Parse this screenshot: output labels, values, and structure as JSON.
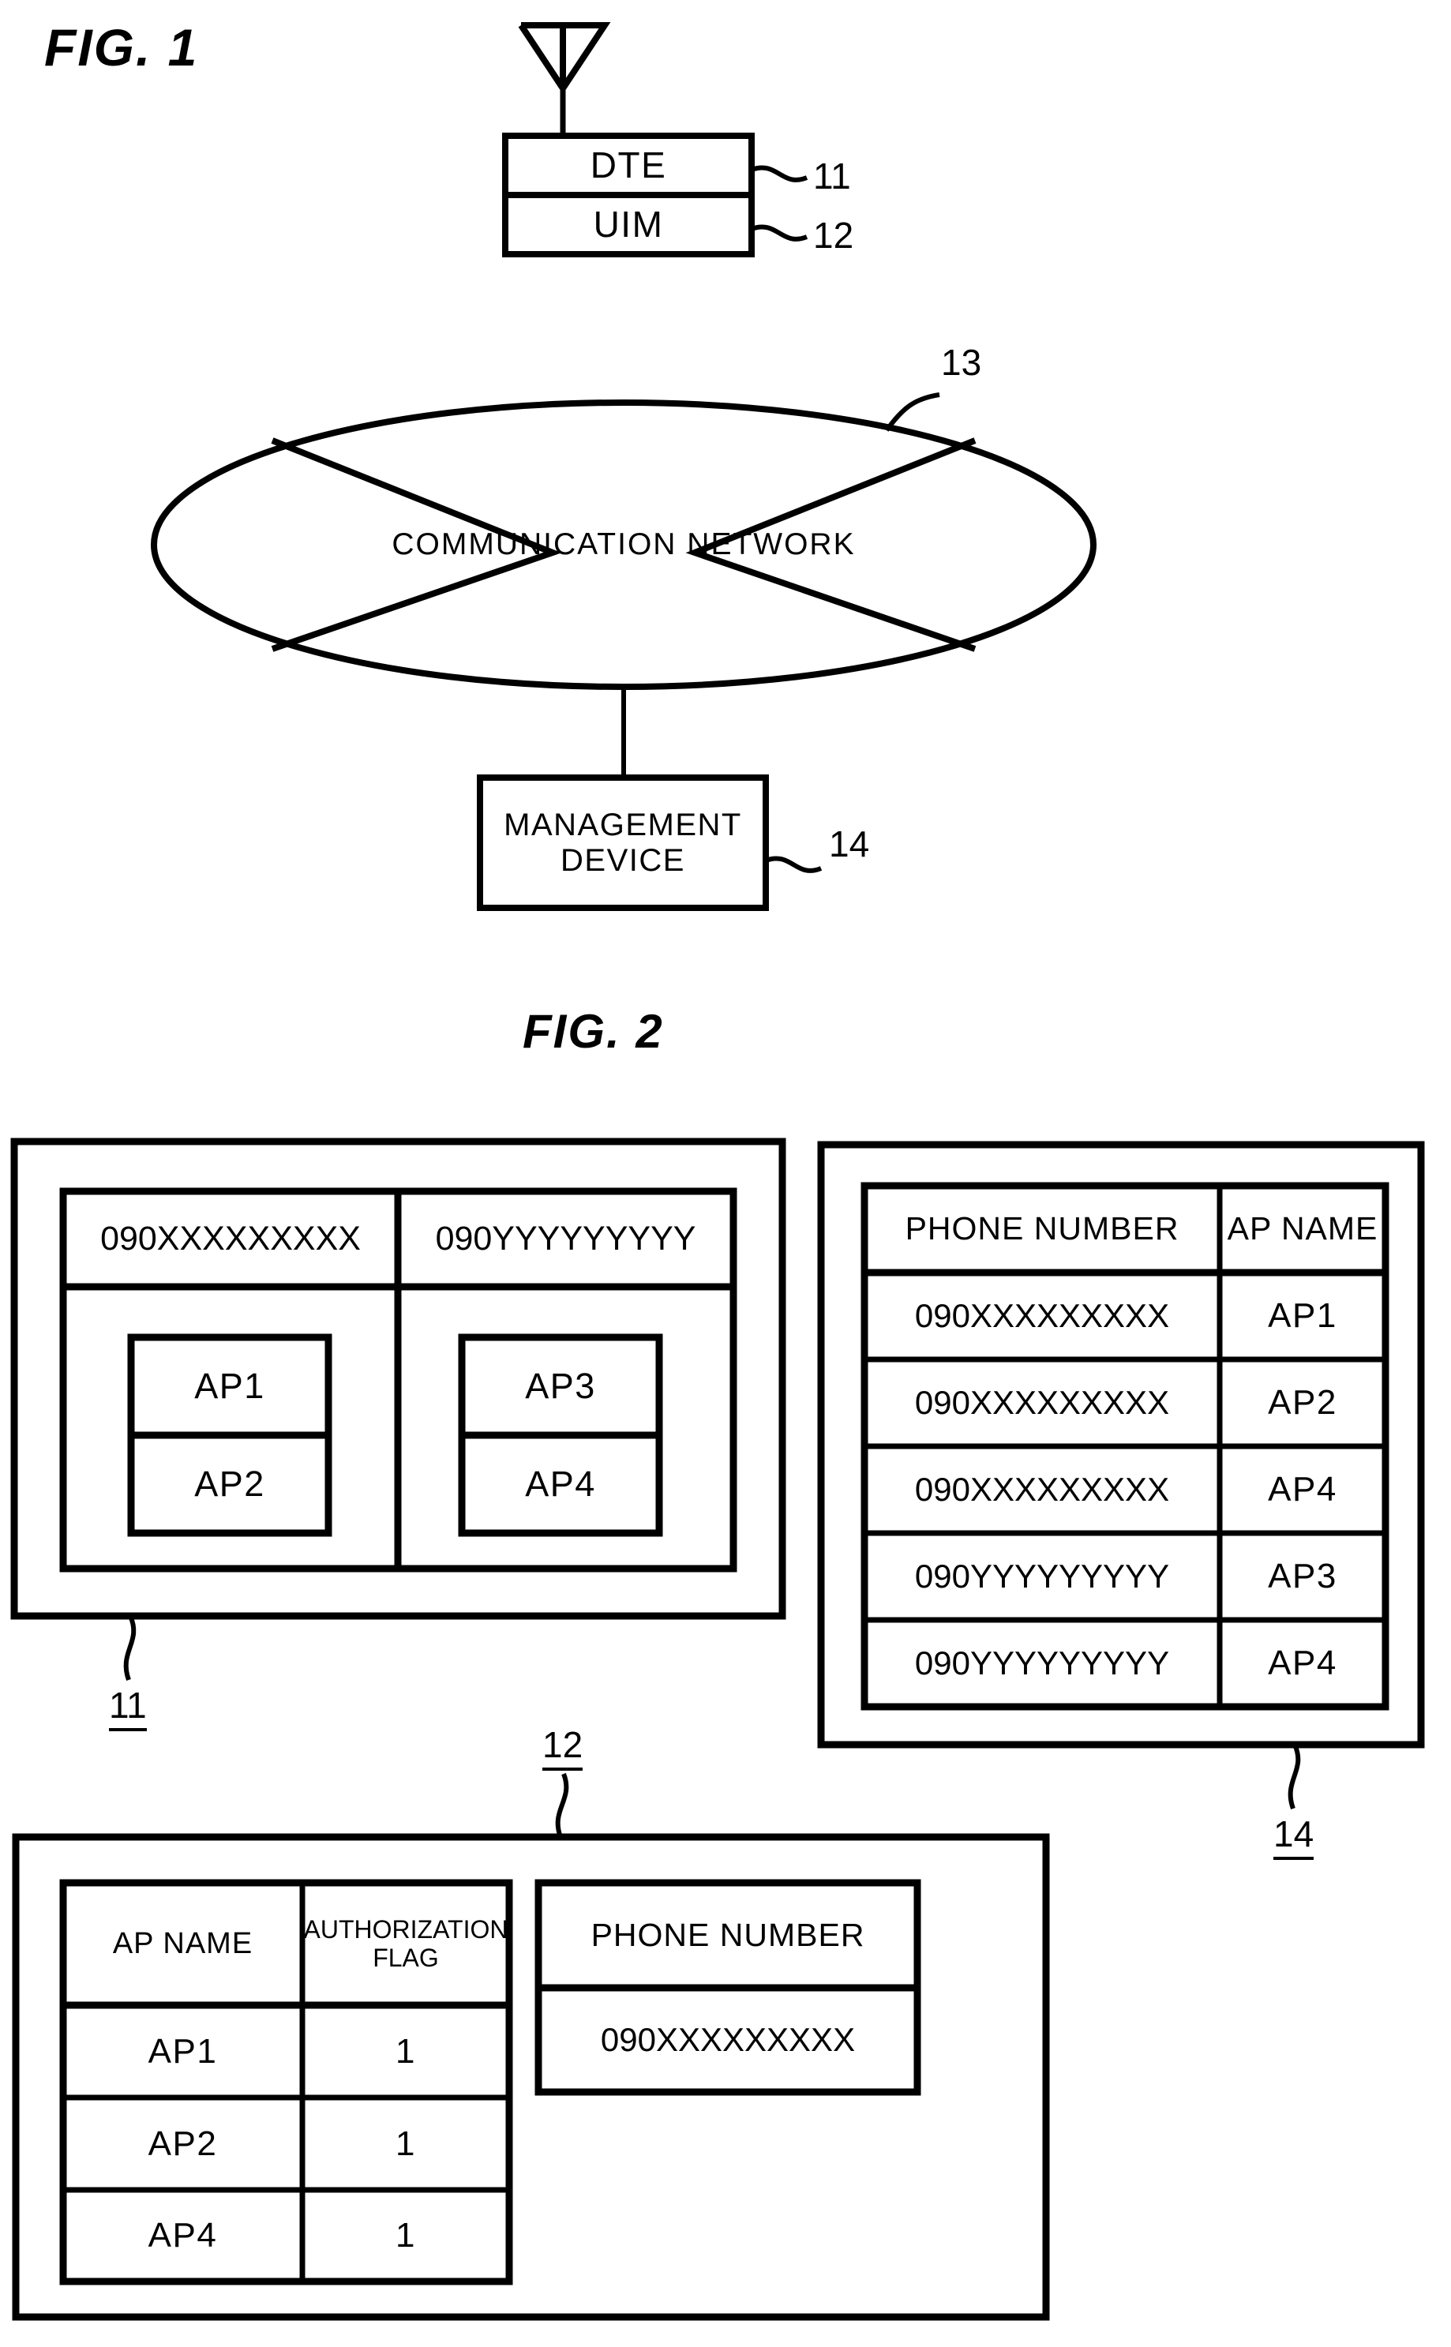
{
  "figures": [
    {
      "id": "fig1",
      "title": "FIG. 1",
      "nodes": {
        "dte": "DTE",
        "uim": "UIM",
        "network": "COMMUNICATION NETWORK",
        "management_device": "MANAGEMENT\nDEVICE"
      },
      "reference_numerals": {
        "dte": "11",
        "uim": "12",
        "network": "13",
        "management_device": "14"
      },
      "icons": {
        "antenna": "antenna-icon"
      }
    },
    {
      "id": "fig2",
      "title": "FIG. 2",
      "panels": [
        {
          "id": "terminal-panel",
          "reference_numeral": "11",
          "columns": [
            {
              "header": "090XXXXXXXXX",
              "items": [
                "AP1",
                "AP2"
              ]
            },
            {
              "header": "090YYYYYYYYY",
              "items": [
                "AP3",
                "AP4"
              ]
            }
          ]
        },
        {
          "id": "management-panel",
          "reference_numeral": "14",
          "table": {
            "headers": [
              "PHONE NUMBER",
              "AP NAME"
            ],
            "rows": [
              [
                "090XXXXXXXXX",
                "AP1"
              ],
              [
                "090XXXXXXXXX",
                "AP2"
              ],
              [
                "090XXXXXXXXX",
                "AP4"
              ],
              [
                "090YYYYYYYYY",
                "AP3"
              ],
              [
                "090YYYYYYYYY",
                "AP4"
              ]
            ]
          }
        },
        {
          "id": "uim-panel",
          "reference_numeral": "12",
          "auth_table": {
            "headers": [
              "AP NAME",
              "AUTHORIZATION\nFLAG"
            ],
            "rows": [
              [
                "AP1",
                "1"
              ],
              [
                "AP2",
                "1"
              ],
              [
                "AP4",
                "1"
              ]
            ]
          },
          "phone_box": {
            "header": "PHONE NUMBER",
            "value": "090XXXXXXXXX"
          }
        }
      ]
    }
  ],
  "colors": {
    "ink": "#000000",
    "paper": "#ffffff"
  }
}
